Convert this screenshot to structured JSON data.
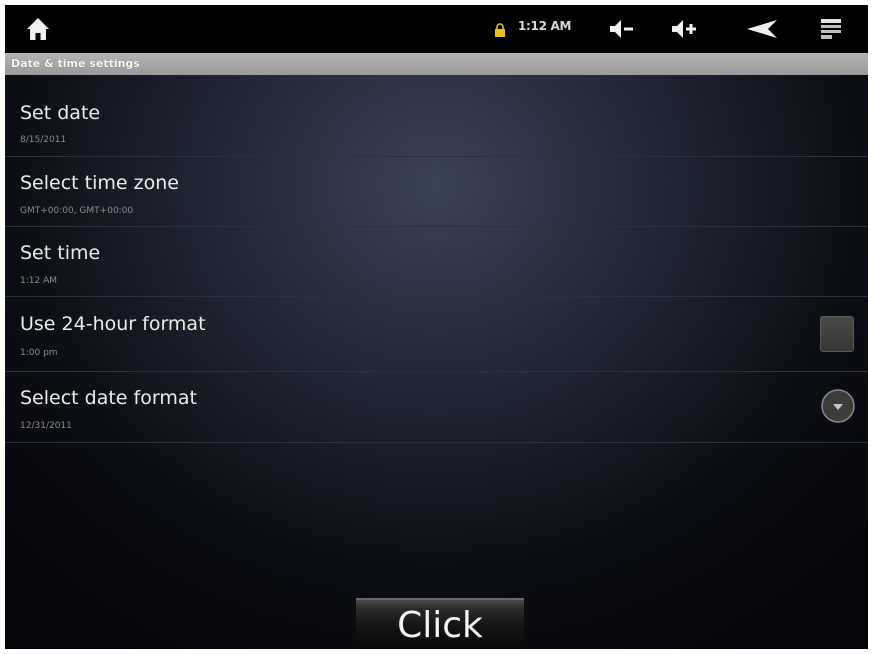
{
  "status_bar": {
    "time": "1:12 AM",
    "icons": {
      "home": "home-icon",
      "lock": "lock-icon",
      "volume_down": "volume-down-icon",
      "volume_up": "volume-up-icon",
      "back": "back-icon",
      "menu": "menu-icon"
    }
  },
  "screen_title": "Date & time settings",
  "settings": [
    {
      "title": "Set date",
      "summary": "8/15/2011"
    },
    {
      "title": "Select time zone",
      "summary": "GMT+00:00, GMT+00:00"
    },
    {
      "title": "Set time",
      "summary": "1:12 AM"
    },
    {
      "title": "Use 24-hour format",
      "summary": "1:00 pm",
      "checked": false
    },
    {
      "title": "Select date format",
      "summary": "12/31/2011"
    }
  ],
  "bottom_button": {
    "label": "Click"
  },
  "colors": {
    "title_strip": "#a8a8a8",
    "text_primary": "#ececec",
    "text_secondary": "#8c8c8c",
    "lock_accent": "#e8c020"
  }
}
